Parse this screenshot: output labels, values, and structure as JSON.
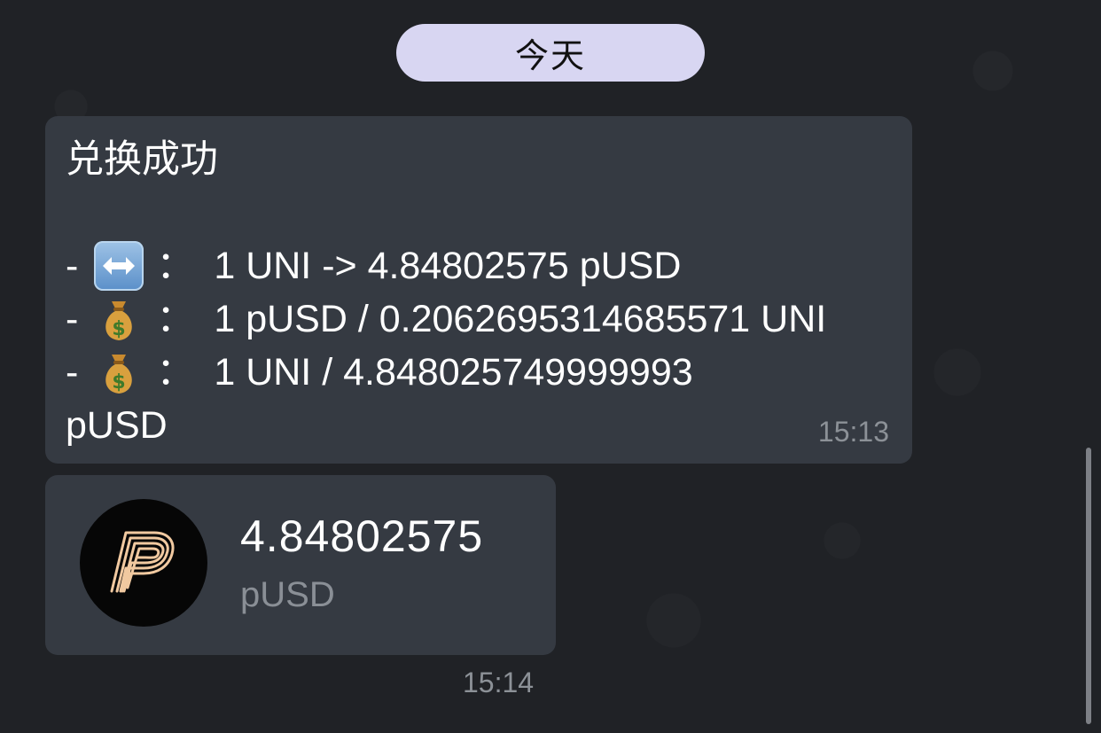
{
  "date_separator": "今天",
  "swap_message": {
    "title": "兑换成功",
    "lines": [
      {
        "prefix": "-",
        "icon": "left-right-arrow-icon",
        "sep": "：",
        "text": "1 UNI -> 4.84802575 pUSD"
      },
      {
        "prefix": "-",
        "icon": "money-bag-icon",
        "sep": "：",
        "text": "1 pUSD / 0.2062695314685571 UNI"
      },
      {
        "prefix": "-",
        "icon": "money-bag-icon",
        "sep": "：",
        "text": "1 UNI / 4.848025749999993"
      }
    ],
    "wrap_line": "pUSD",
    "time": "15:13"
  },
  "token_message": {
    "icon": "pusd-logo-icon",
    "amount": "4.84802575",
    "symbol": "pUSD",
    "time": "15:14"
  },
  "colors": {
    "background": "#202226",
    "bubble": "#353a42",
    "date_pill": "#d8d6f2",
    "muted_text": "#8c9197",
    "logo_gold": "#f1c9a0"
  }
}
